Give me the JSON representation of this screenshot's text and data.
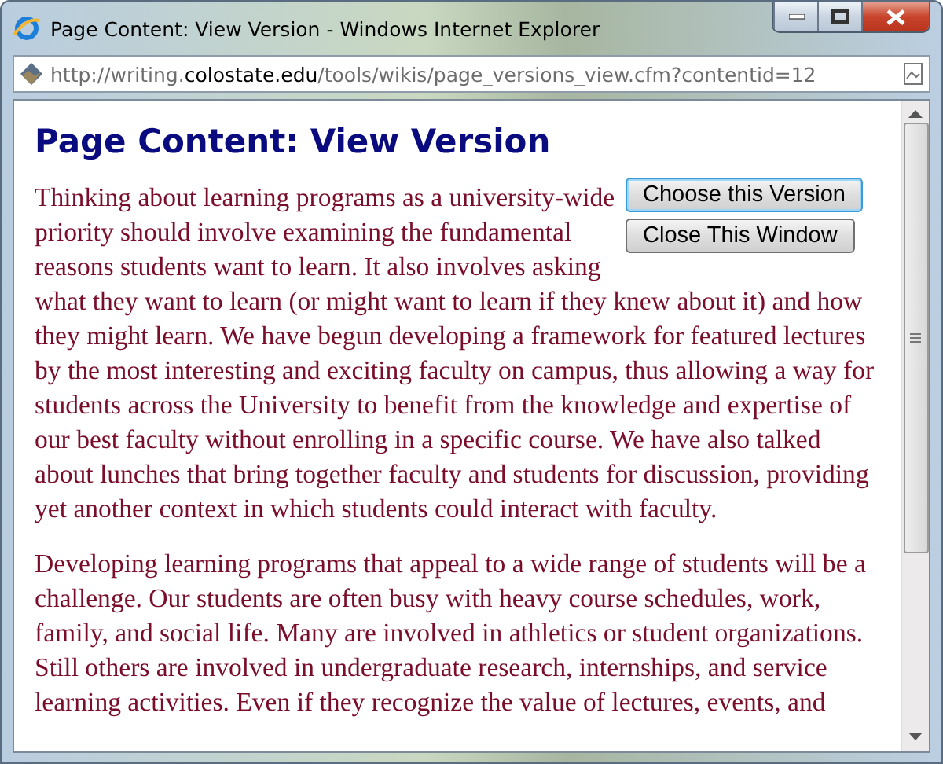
{
  "window": {
    "title": "Page Content: View Version - Windows Internet Explorer"
  },
  "address_bar": {
    "url": "http://writing.**colostate.edu**/tools/wikis/page_versions_view.cfm?contentid=12"
  },
  "page": {
    "heading": "Page Content: View Version",
    "buttons": [
      {
        "label": "Choose this Version",
        "focused": true
      },
      {
        "label": "Close This Window",
        "focused": false
      }
    ],
    "intro": "Thinking about learning programs as a university-wide priority should involve examining the fundamental reasons students want to learn. It also involves asking",
    "paragraphs": [
      "what they want to learn (or might want to learn if they knew about it) and how they might learn. We have begun developing a framework for featured lectures by the most interesting and exciting faculty on campus, thus allowing a way for students across the University to benefit from the knowledge and expertise of our best faculty without enrolling in a specific course. We have also talked about lunches that bring together faculty and students for discussion, providing yet another context in which students could interact with faculty.",
      "Developing learning programs that appeal to a wide range of students will be a challenge. Our students are often busy with heavy course schedules, work, family, and social life. Many are involved in athletics or student organizations. Still others are involved in undergraduate research, internships, and service learning activities. Even if they recognize the value of lectures, events, and"
    ]
  }
}
